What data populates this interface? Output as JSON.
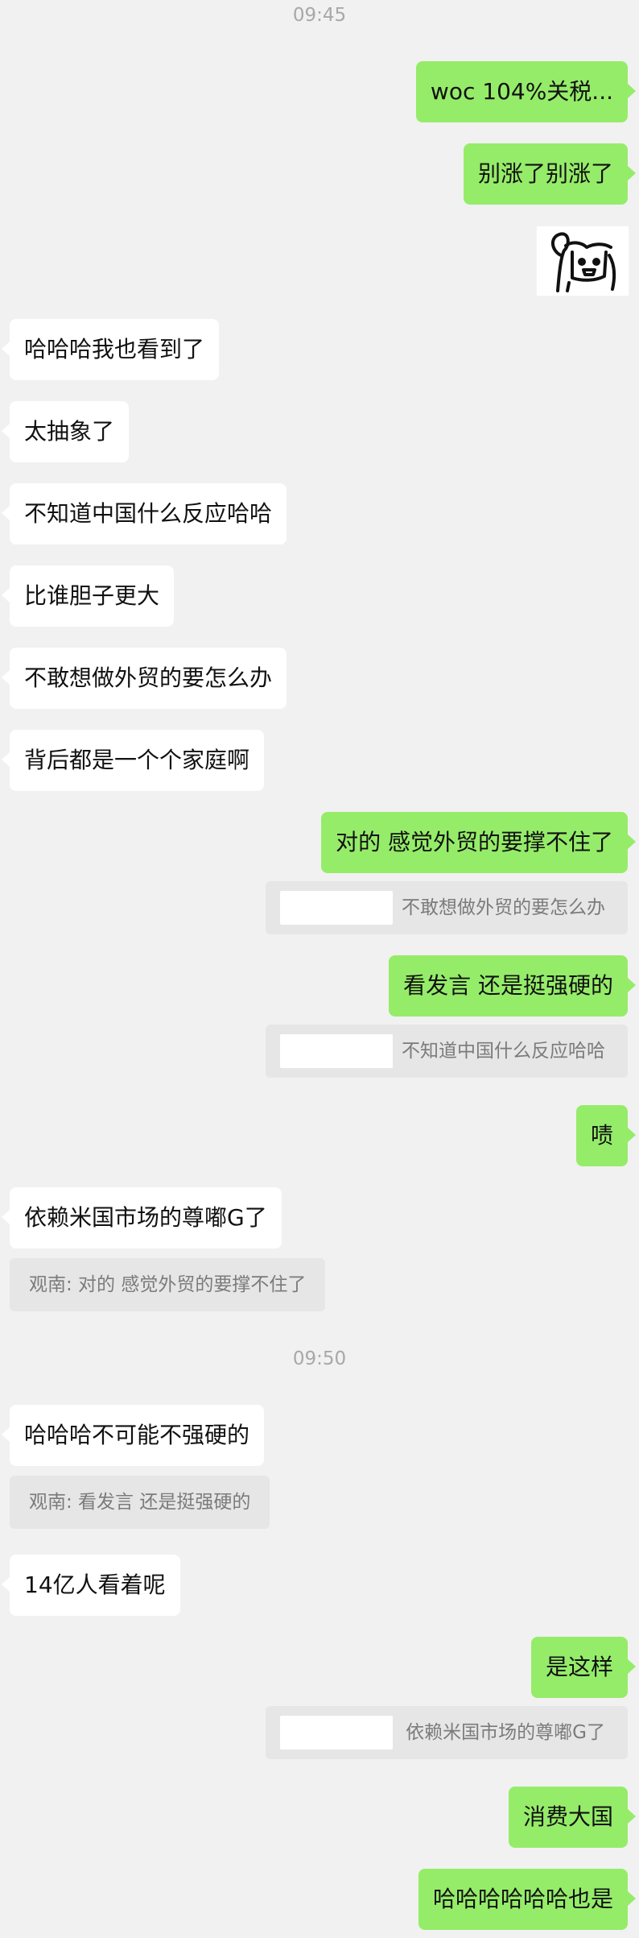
{
  "timestamps": [
    "09:45",
    "09:50"
  ],
  "messages": {
    "m1": "woc 104%关税...",
    "m2": "别涨了别涨了",
    "m4": "哈哈哈我也看到了",
    "m5": "太抽象了",
    "m6": "不知道中国什么反应哈哈",
    "m7": "比谁胆子更大",
    "m8": "不敢想做外贸的要怎么办",
    "m9": "背后都是一个个家庭啊",
    "m10": "对的 感觉外贸的要撑不住了",
    "m11": "看发言 还是挺强硬的",
    "m12": "啧",
    "m13": "依赖米国市场的尊嘟G了",
    "m14": "哈哈哈不可能不强硬的",
    "m15": "14亿人看着呢",
    "m16": "是这样",
    "m17": "消费大国",
    "m18": "哈哈哈哈哈哈也是"
  },
  "quotes": {
    "q10": "不敢想做外贸的要怎么办",
    "q11": "不知道中国什么反应哈哈",
    "q13": "观南: 对的 感觉外贸的要撑不住了",
    "q14": "观南: 看发言 还是挺强硬的",
    "q16": "依赖米国市场的尊嘟G了"
  },
  "sticker": {
    "icon": "doodle-sticker"
  },
  "colors": {
    "background": "#f1f1f1",
    "outgoing_bubble": "#95ec69",
    "incoming_bubble": "#ffffff",
    "quote_bg": "#e6e6e6"
  }
}
